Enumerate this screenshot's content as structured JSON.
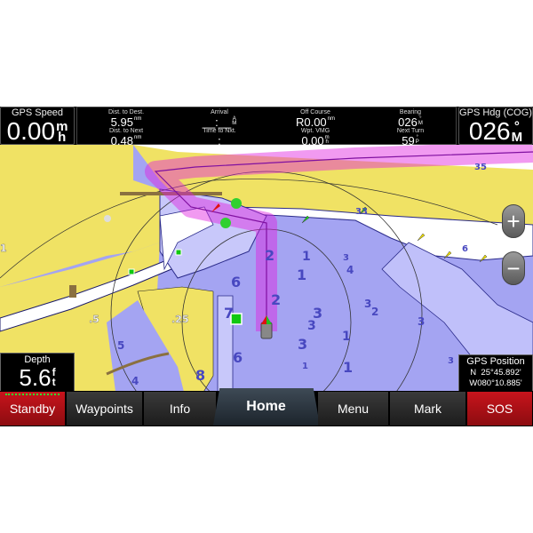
{
  "data_bar": {
    "gps_speed": {
      "label": "GPS Speed",
      "value": "0.00",
      "unit_top": "m",
      "unit_bottom": "h"
    },
    "dist_to_dest": {
      "label": "Dist. to Dest.",
      "value": "5.95",
      "unit": "nm"
    },
    "dist_to_next": {
      "label": "Dist. to Next",
      "value": "0.48",
      "unit": "nm"
    },
    "arrival": {
      "label": "Arrival",
      "value": "__:__",
      "unit_top": "A",
      "unit_bottom": "M"
    },
    "time_to_next": {
      "label": "Time to Nxt.",
      "value": "__:__"
    },
    "off_course": {
      "label": "Off Course",
      "value": "R0.00",
      "unit": "nm"
    },
    "wpt_vmg": {
      "label": "Wpt. VMG",
      "value": "0.00",
      "unit_top": "m",
      "unit_bottom": "h"
    },
    "bearing": {
      "label": "Bearing",
      "value": "026",
      "unit_top": "°",
      "unit_bottom": "M"
    },
    "next_turn": {
      "label": "Next Turn",
      "value": "59",
      "unit_top": "°",
      "unit_bottom": "P"
    },
    "gps_heading": {
      "label": "GPS Hdg (COG)",
      "value": "026",
      "unit_top": "°",
      "unit_bottom": "M"
    }
  },
  "depth": {
    "label": "Depth",
    "value": "5.6",
    "unit_top": "f",
    "unit_bottom": "t"
  },
  "gps_position": {
    "label": "GPS Position",
    "lat": "N  25°45.892'",
    "lon": "W080°10.885'"
  },
  "zoom_controls": {
    "zoom_in": "+",
    "zoom_out": "−"
  },
  "nav": {
    "standby": "Standby",
    "waypoints": "Waypoints",
    "info": "Info",
    "home": "Home",
    "menu": "Menu",
    "mark": "Mark",
    "sos": "SOS"
  },
  "map": {
    "soundings": [
      "2",
      "1",
      "4",
      "2",
      "1",
      "3",
      "3",
      "1",
      "3",
      "6",
      "7",
      "6",
      "8",
      "5",
      "4",
      "2",
      "3",
      "3",
      "1",
      "3",
      "3",
      "33",
      "35",
      "6",
      "1"
    ],
    "light_labels": [
      ".5",
      ".25",
      "1"
    ],
    "colors": {
      "land": "#f0e264",
      "shallow": "#a8a8f4",
      "deep": "#c0c0f8",
      "dry": "#ffffff",
      "route": "#e020e0"
    }
  }
}
